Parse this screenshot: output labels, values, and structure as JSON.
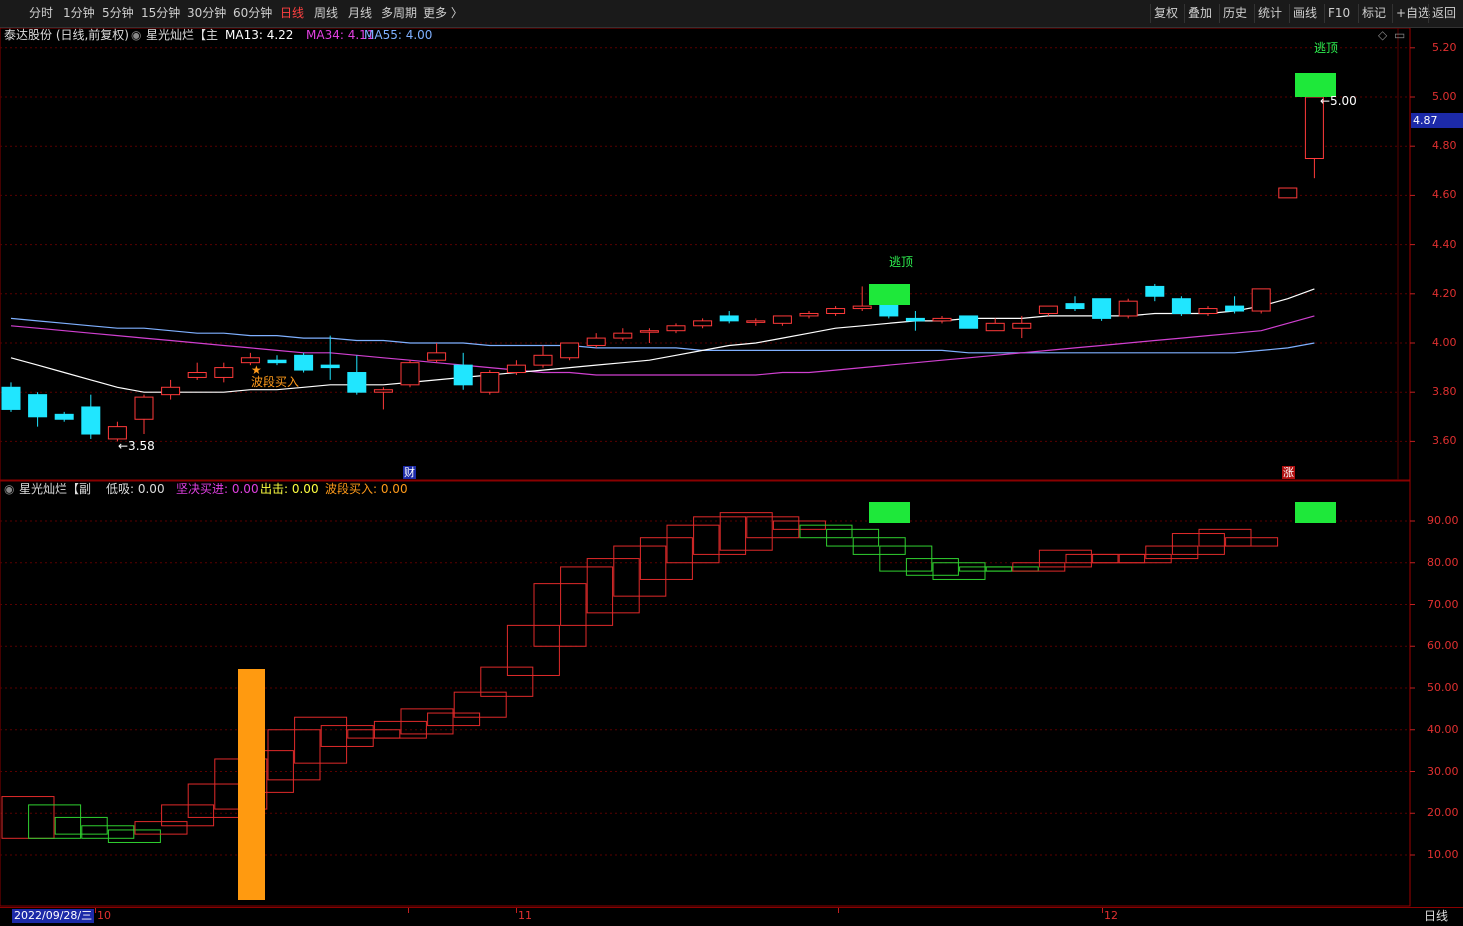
{
  "toolbar": {
    "periods": [
      "分时",
      "1分钟",
      "5分钟",
      "15分钟",
      "30分钟",
      "60分钟",
      "日线",
      "周线",
      "月线",
      "多周期",
      "更多 〉"
    ],
    "active": "日线",
    "right_buttons": [
      "复权",
      "叠加",
      "历史",
      "统计",
      "画线",
      "F10",
      "标记",
      "+自选",
      "返回"
    ]
  },
  "main_panel": {
    "stock": "泰达股份 (日线,前复权)",
    "indicator": "星光灿烂【主",
    "ma": [
      {
        "label": "MA13: 4.22",
        "color": "#ffffff"
      },
      {
        "label": "MA34: 4.11",
        "color": "#e040e0"
      },
      {
        "label": "MA55: 4.00",
        "color": "#7fb0ff"
      }
    ],
    "yticks": [
      "5.20",
      "5.00",
      "4.80",
      "4.60",
      "4.40",
      "4.20",
      "4.00",
      "3.80",
      "3.60"
    ],
    "current_price": "4.87",
    "annotations": {
      "high_label": "5.00",
      "low_label": "3.58",
      "escape_top_1": "逃顶",
      "escape_top_2": "逃顶",
      "band_buy": "波段买入",
      "star": "★",
      "finance": "财",
      "limit_up": "涨"
    }
  },
  "sub_panel": {
    "indicator": "星光灿烂【副",
    "items": [
      {
        "label": "低吸: 0.00",
        "color": "#dddddd"
      },
      {
        "label": "坚决买进: 0.00",
        "color": "#e040e0"
      },
      {
        "label": "出击: 0.00",
        "color": "#ffff40"
      },
      {
        "label": "波段买入: 0.00",
        "color": "#ff9a1a"
      }
    ],
    "yticks": [
      "90.00",
      "80.00",
      "70.00",
      "60.00",
      "50.00",
      "40.00",
      "30.00",
      "20.00",
      "10.00"
    ]
  },
  "bottom": {
    "date": "2022/09/28/三",
    "months": [
      "10",
      "11",
      "12"
    ],
    "period": "日线"
  },
  "chart_data": {
    "type": "candlestick",
    "candles": [
      [
        3.82,
        3.73,
        3.84,
        3.72
      ],
      [
        3.79,
        3.7,
        3.8,
        3.66
      ],
      [
        3.71,
        3.69,
        3.72,
        3.68
      ],
      [
        3.74,
        3.63,
        3.79,
        3.61
      ],
      [
        3.61,
        3.66,
        3.68,
        3.6
      ],
      [
        3.69,
        3.78,
        3.79,
        3.63
      ],
      [
        3.79,
        3.82,
        3.85,
        3.77
      ],
      [
        3.86,
        3.88,
        3.92,
        3.85
      ],
      [
        3.86,
        3.9,
        3.92,
        3.84
      ],
      [
        3.92,
        3.94,
        3.96,
        3.91
      ],
      [
        3.93,
        3.92,
        3.95,
        3.91
      ],
      [
        3.95,
        3.89,
        3.96,
        3.88
      ],
      [
        3.91,
        3.9,
        4.03,
        3.85
      ],
      [
        3.88,
        3.8,
        3.95,
        3.79
      ],
      [
        3.8,
        3.81,
        3.82,
        3.73
      ],
      [
        3.83,
        3.92,
        3.93,
        3.82
      ],
      [
        3.93,
        3.96,
        4.0,
        3.92
      ],
      [
        3.91,
        3.83,
        3.96,
        3.81
      ],
      [
        3.8,
        3.88,
        3.89,
        3.79
      ],
      [
        3.88,
        3.91,
        3.93,
        3.87
      ],
      [
        3.91,
        3.95,
        3.99,
        3.9
      ],
      [
        3.94,
        4.0,
        4.0,
        3.93
      ],
      [
        3.99,
        4.02,
        4.04,
        3.98
      ],
      [
        4.02,
        4.04,
        4.06,
        4.01
      ],
      [
        4.05,
        4.05,
        4.06,
        4.0
      ],
      [
        4.05,
        4.07,
        4.08,
        4.04
      ],
      [
        4.07,
        4.09,
        4.1,
        4.06
      ],
      [
        4.11,
        4.09,
        4.13,
        4.08
      ],
      [
        4.09,
        4.09,
        4.1,
        4.07
      ],
      [
        4.08,
        4.11,
        4.11,
        4.07
      ],
      [
        4.11,
        4.12,
        4.13,
        4.1
      ],
      [
        4.12,
        4.14,
        4.15,
        4.11
      ],
      [
        4.14,
        4.15,
        4.23,
        4.13
      ],
      [
        4.16,
        4.11,
        4.18,
        4.1
      ],
      [
        4.1,
        4.09,
        4.13,
        4.05
      ],
      [
        4.09,
        4.1,
        4.11,
        4.08
      ],
      [
        4.11,
        4.06,
        4.11,
        4.06
      ],
      [
        4.05,
        4.08,
        4.1,
        4.05
      ],
      [
        4.06,
        4.08,
        4.11,
        4.02
      ],
      [
        4.12,
        4.15,
        4.15,
        4.11
      ],
      [
        4.16,
        4.14,
        4.19,
        4.13
      ],
      [
        4.18,
        4.1,
        4.18,
        4.09
      ],
      [
        4.11,
        4.17,
        4.18,
        4.1
      ],
      [
        4.23,
        4.19,
        4.24,
        4.17
      ],
      [
        4.18,
        4.12,
        4.19,
        4.11
      ],
      [
        4.12,
        4.14,
        4.15,
        4.11
      ],
      [
        4.15,
        4.13,
        4.19,
        4.12
      ],
      [
        4.13,
        4.22,
        4.22,
        4.12
      ],
      [
        4.59,
        4.63,
        4.63,
        4.59
      ],
      [
        4.75,
        5.0,
        5.0,
        4.67
      ]
    ],
    "ma13": [
      3.94,
      3.91,
      3.88,
      3.85,
      3.82,
      3.8,
      3.8,
      3.8,
      3.8,
      3.81,
      3.81,
      3.82,
      3.83,
      3.83,
      3.83,
      3.84,
      3.85,
      3.86,
      3.87,
      3.88,
      3.89,
      3.9,
      3.91,
      3.92,
      3.93,
      3.95,
      3.97,
      3.99,
      4.0,
      4.02,
      4.04,
      4.06,
      4.07,
      4.08,
      4.09,
      4.09,
      4.1,
      4.1,
      4.1,
      4.11,
      4.11,
      4.11,
      4.11,
      4.12,
      4.12,
      4.12,
      4.13,
      4.15,
      4.18,
      4.22
    ],
    "ma34": [
      4.07,
      4.06,
      4.05,
      4.04,
      4.03,
      4.02,
      4.01,
      4.0,
      3.99,
      3.98,
      3.97,
      3.96,
      3.96,
      3.95,
      3.94,
      3.93,
      3.92,
      3.91,
      3.9,
      3.89,
      3.88,
      3.88,
      3.87,
      3.87,
      3.87,
      3.87,
      3.87,
      3.87,
      3.87,
      3.88,
      3.88,
      3.89,
      3.9,
      3.91,
      3.92,
      3.93,
      3.94,
      3.95,
      3.96,
      3.97,
      3.98,
      3.99,
      4.0,
      4.01,
      4.02,
      4.03,
      4.04,
      4.05,
      4.08,
      4.11
    ],
    "ma55": [
      4.1,
      4.09,
      4.08,
      4.07,
      4.06,
      4.06,
      4.05,
      4.04,
      4.04,
      4.03,
      4.03,
      4.02,
      4.02,
      4.01,
      4.01,
      4.0,
      4.0,
      4.0,
      3.99,
      3.99,
      3.99,
      3.99,
      3.98,
      3.98,
      3.98,
      3.98,
      3.97,
      3.97,
      3.97,
      3.97,
      3.97,
      3.97,
      3.97,
      3.97,
      3.97,
      3.97,
      3.96,
      3.96,
      3.96,
      3.96,
      3.96,
      3.96,
      3.96,
      3.96,
      3.96,
      3.96,
      3.96,
      3.97,
      3.98,
      4.0
    ],
    "sub_boxes": [
      [
        14,
        24,
        "up",
        0
      ],
      [
        14,
        22,
        "dn",
        1
      ],
      [
        15,
        19,
        "dn",
        2
      ],
      [
        14,
        17,
        "dn",
        3
      ],
      [
        13,
        16,
        "dn",
        4
      ],
      [
        15,
        18,
        "up",
        5
      ],
      [
        17,
        22,
        "up",
        6
      ],
      [
        19,
        27,
        "up",
        7
      ],
      [
        21,
        33,
        "up",
        8
      ],
      [
        25,
        35,
        "up",
        9
      ],
      [
        28,
        40,
        "up",
        10
      ],
      [
        32,
        43,
        "up",
        11
      ],
      [
        36,
        41,
        "up",
        12
      ],
      [
        38,
        40,
        "up",
        13
      ],
      [
        38,
        42,
        "up",
        14
      ],
      [
        39,
        45,
        "up",
        15
      ],
      [
        41,
        44,
        "up",
        16
      ],
      [
        43,
        49,
        "up",
        17
      ],
      [
        48,
        55,
        "up",
        18
      ],
      [
        53,
        65,
        "up",
        19
      ],
      [
        60,
        75,
        "up",
        20
      ],
      [
        65,
        79,
        "up",
        21
      ],
      [
        68,
        81,
        "up",
        22
      ],
      [
        72,
        84,
        "up",
        23
      ],
      [
        76,
        86,
        "up",
        24
      ],
      [
        80,
        89,
        "up",
        25
      ],
      [
        82,
        91,
        "up",
        26
      ],
      [
        83,
        92,
        "up",
        27
      ],
      [
        86,
        91,
        "up",
        28
      ],
      [
        88,
        90,
        "up",
        29
      ],
      [
        86,
        89,
        "dn",
        30
      ],
      [
        84,
        88,
        "dn",
        31
      ],
      [
        82,
        86,
        "dn",
        32
      ],
      [
        78,
        84,
        "dn",
        33
      ],
      [
        77,
        81,
        "dn",
        34
      ],
      [
        76,
        80,
        "dn",
        35
      ],
      [
        78,
        79,
        "dn",
        36
      ],
      [
        78,
        79,
        "dn",
        37
      ],
      [
        78,
        80,
        "up",
        38
      ],
      [
        79,
        83,
        "up",
        39
      ],
      [
        80,
        82,
        "up",
        40
      ],
      [
        80,
        82,
        "up",
        41
      ],
      [
        80,
        82,
        "up",
        42
      ],
      [
        81,
        84,
        "up",
        43
      ],
      [
        82,
        87,
        "up",
        44
      ],
      [
        84,
        88,
        "up",
        45
      ],
      [
        84,
        86,
        "up",
        46
      ]
    ]
  }
}
